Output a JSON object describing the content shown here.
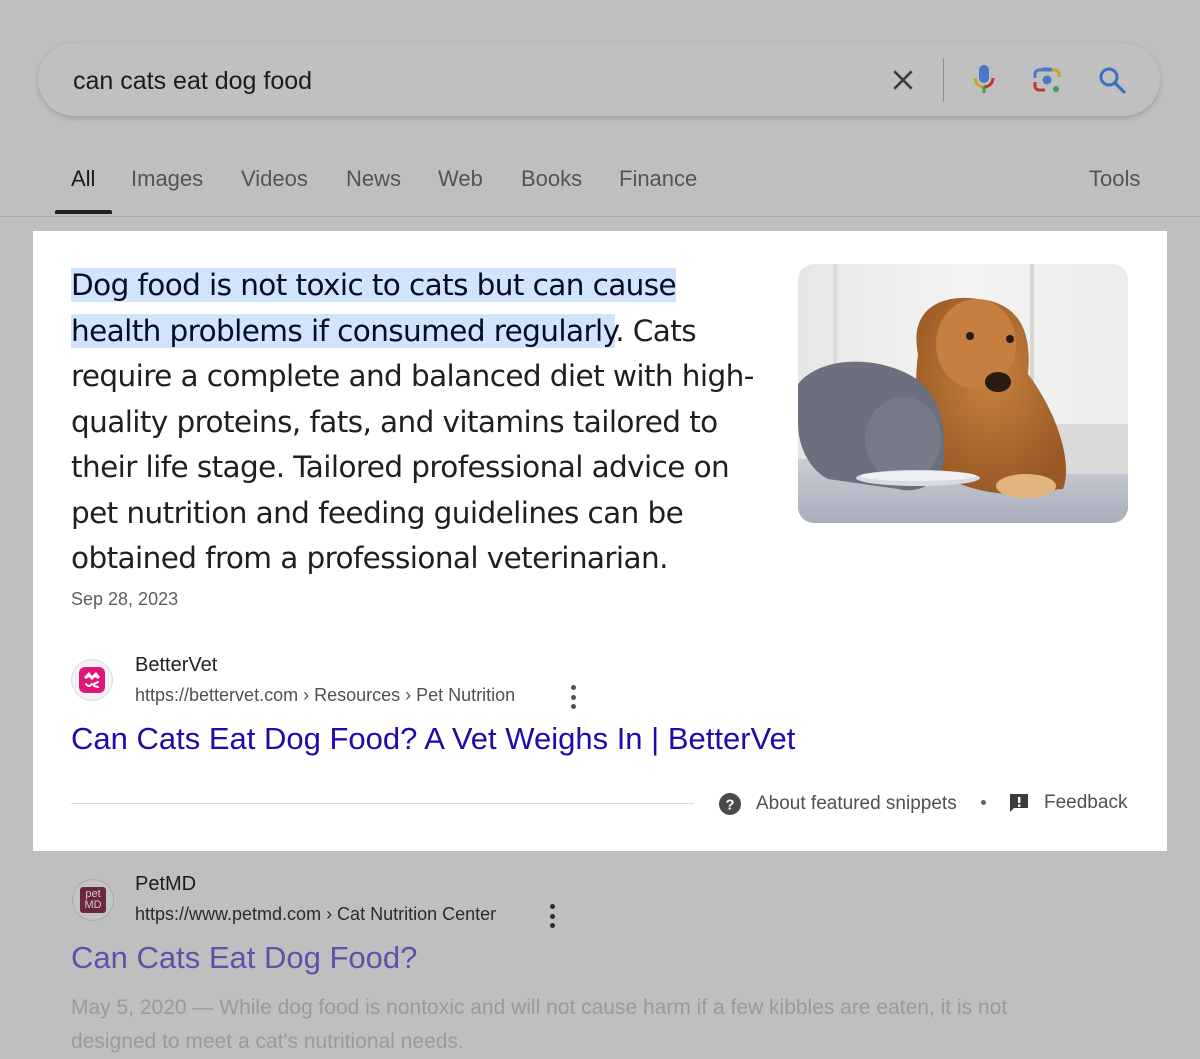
{
  "search": {
    "query": "can cats eat dog food",
    "icons": [
      "close-icon",
      "microphone-icon",
      "camera-lens-icon",
      "search-icon"
    ]
  },
  "tabs": [
    {
      "label": "All",
      "active": true
    },
    {
      "label": "Images"
    },
    {
      "label": "Videos"
    },
    {
      "label": "News"
    },
    {
      "label": "Web"
    },
    {
      "label": "Books"
    },
    {
      "label": "Finance"
    }
  ],
  "tools_label": "Tools",
  "featured": {
    "highlight": "Dog food is not toxic to cats but can cause health problems if consumed regularly",
    "rest": ". Cats require a complete and balanced diet with high-quality proteins, fats, and vitamins tailored to their life stage. Tailored professional advice on pet nutrition and feeding guidelines can be obtained from a professional veterinarian.",
    "date": "Sep 28, 2023",
    "image_alt": "Gray cat eating from a plate next to a golden retriever",
    "source": {
      "name": "BetterVet",
      "url": "https://bettervet.com › Resources › Pet Nutrition",
      "title": "Can Cats Eat Dog Food? A Vet Weighs In | BetterVet"
    },
    "about_label": "About featured snippets",
    "feedback_label": "Feedback"
  },
  "result2": {
    "name": "PetMD",
    "favicon_text": [
      "pet",
      "MD"
    ],
    "url": "https://www.petmd.com › Cat Nutrition Center",
    "title": "Can Cats Eat Dog Food?",
    "date": "May 5, 2020",
    "snippet": " — While dog food is nontoxic and will not cause harm if a few kibbles are eaten, it is not designed to meet a cat's nutritional needs."
  },
  "colors": {
    "link": "#1a0dab",
    "visited_link": "#5e52a8",
    "highlight": "#d2e3fc",
    "dim_overlay": "#bfbfbf"
  }
}
